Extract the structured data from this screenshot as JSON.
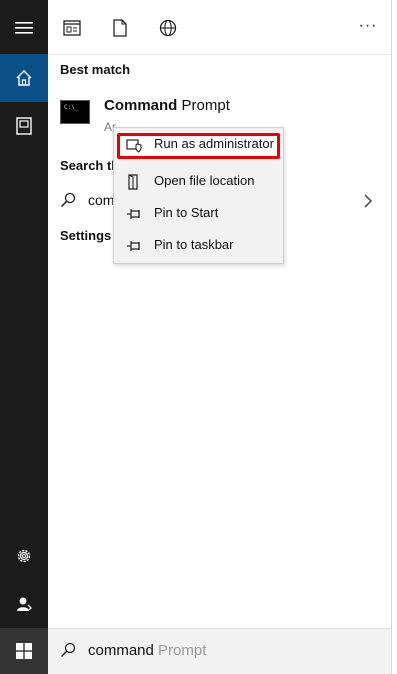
{
  "rail": {
    "items": [
      {
        "icon": "hamburger-menu-icon"
      },
      {
        "icon": "home-icon",
        "active": true
      },
      {
        "icon": "documents-icon"
      },
      {
        "icon": "settings-gear-icon"
      },
      {
        "icon": "user-account-icon"
      }
    ],
    "start_icon": "windows-logo-icon"
  },
  "topbar": {
    "icons": [
      "apps-icon",
      "documents-icon",
      "web-globe-icon",
      "more-options-icon"
    ],
    "more_label": "···"
  },
  "best_match": {
    "heading": "Best match",
    "app_name_bold": "Command",
    "app_name_rest": " Prompt",
    "subtitle": "App"
  },
  "search_web": {
    "heading": "Search the web",
    "query": "command"
  },
  "settings": {
    "heading": "Settings"
  },
  "context_menu": {
    "items": [
      {
        "label": "Run as administrator",
        "icon": "shield-admin-icon",
        "highlighted": true
      },
      {
        "label": "Open file location",
        "icon": "file-location-icon"
      },
      {
        "label": "Pin to Start",
        "icon": "pin-icon"
      },
      {
        "label": "Pin to taskbar",
        "icon": "pin-icon"
      }
    ],
    "highlight_color": "#e60000"
  },
  "search_box": {
    "typed": "command",
    "suggestion": " Prompt"
  },
  "colors": {
    "rail_bg": "#1b1b1b",
    "active_accent": "#0a4f86",
    "menu_bg": "#f2f2f2"
  }
}
